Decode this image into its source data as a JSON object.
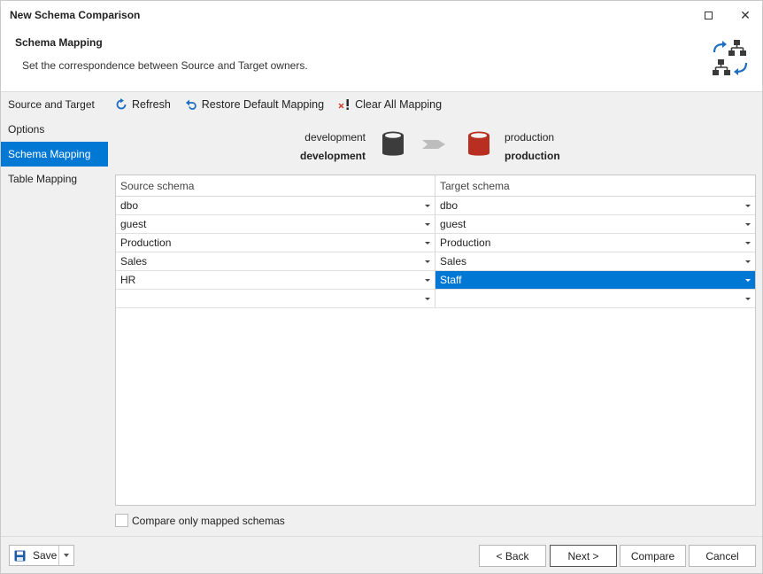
{
  "window": {
    "title": "New Schema Comparison",
    "maximize_icon": "maximize-icon",
    "close_glyph": "✕"
  },
  "header": {
    "title": "Schema Mapping",
    "subtitle": "Set the correspondence between Source and Target owners.",
    "icon": "schema-mapping-icon"
  },
  "nav": {
    "items": [
      {
        "label": "Source and Target",
        "active": false
      },
      {
        "label": "Options",
        "active": false
      },
      {
        "label": "Schema Mapping",
        "active": true
      },
      {
        "label": "Table Mapping",
        "active": false
      }
    ]
  },
  "toolbar": {
    "refresh": "Refresh",
    "restore": "Restore Default Mapping",
    "clear": "Clear All Mapping"
  },
  "connection": {
    "source_name": "development",
    "source_db": "development",
    "target_name": "production",
    "target_db": "production",
    "source_color": "#3c3c3c",
    "target_color": "#b82f22"
  },
  "grid": {
    "headers": [
      "Source schema",
      "Target schema"
    ],
    "rows": [
      {
        "source": "dbo",
        "target": "dbo"
      },
      {
        "source": "guest",
        "target": "guest"
      },
      {
        "source": "Production",
        "target": "Production"
      },
      {
        "source": "Sales",
        "target": "Sales"
      },
      {
        "source": "HR",
        "target": "Staff"
      },
      {
        "source": "",
        "target": ""
      }
    ],
    "selected_row": 4
  },
  "options": {
    "compare_only_mapped": "Compare only mapped schemas"
  },
  "footer": {
    "save": "Save",
    "back": "< Back",
    "next": "Next >",
    "compare": "Compare",
    "cancel": "Cancel"
  },
  "colors": {
    "accent": "#0078d4"
  }
}
